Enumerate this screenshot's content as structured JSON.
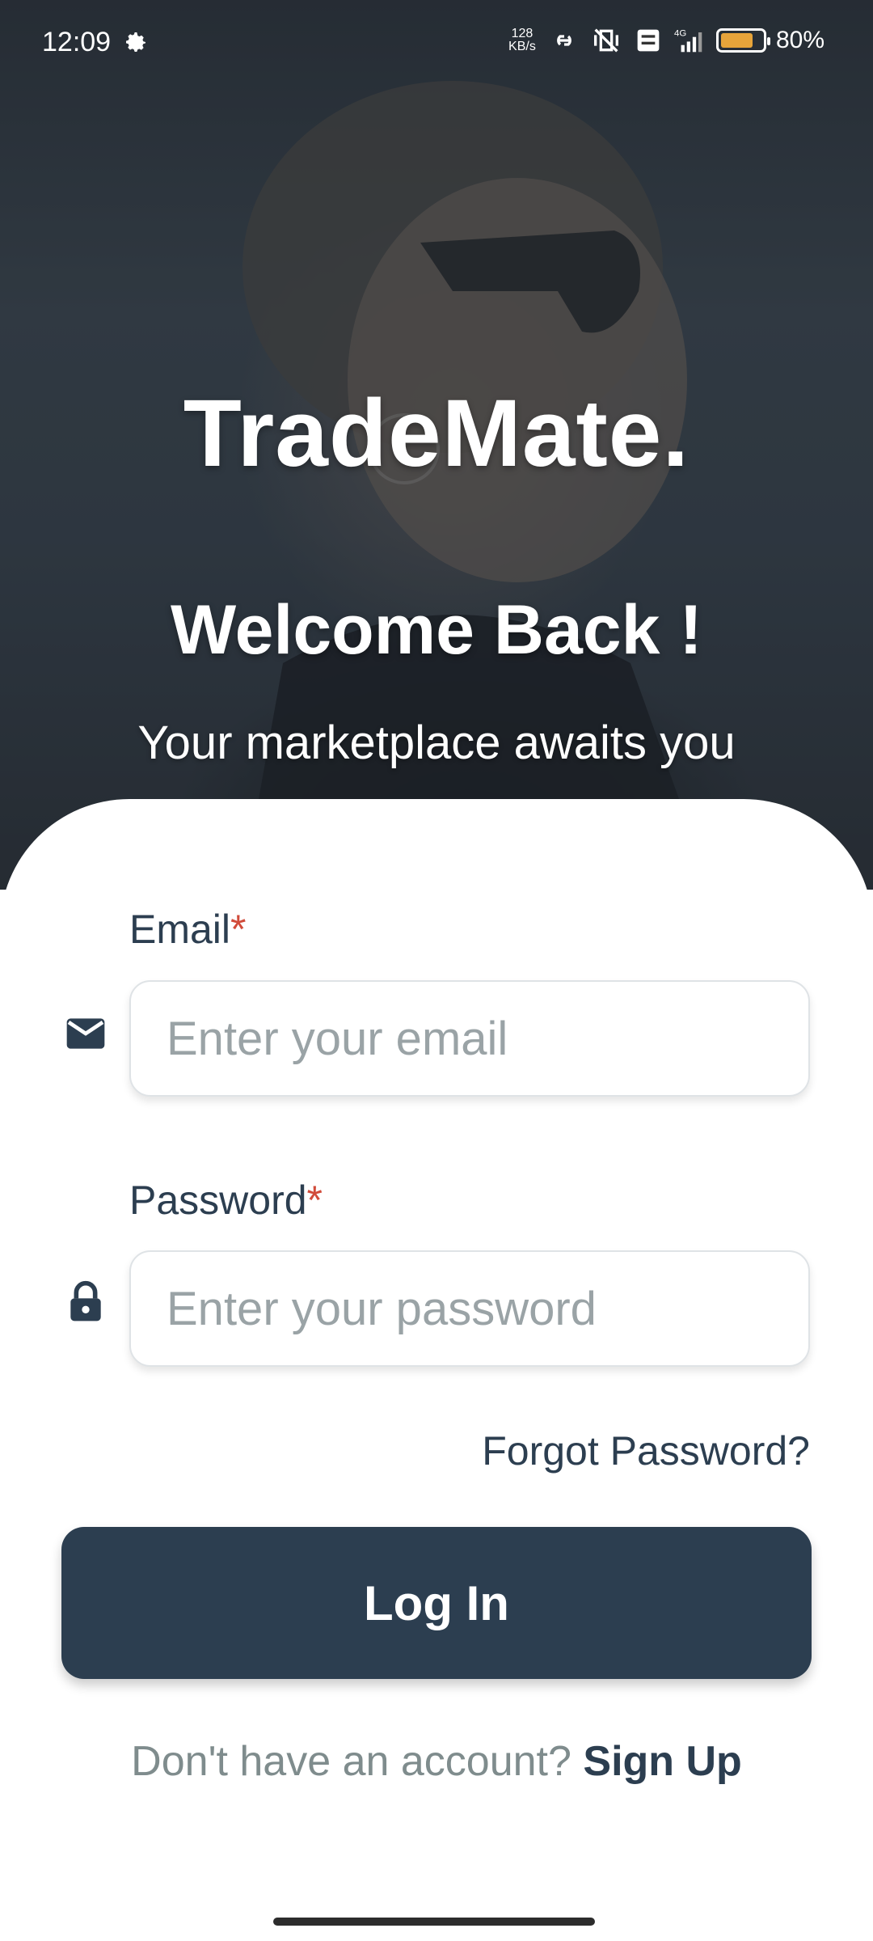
{
  "status_bar": {
    "time": "12:09",
    "speed_top": "128",
    "speed_unit": "KB/s",
    "network": "4G",
    "battery_percent": "80%",
    "battery_level": 0.8
  },
  "hero": {
    "brand": "TradeMate.",
    "welcome": "Welcome Back !",
    "tagline": "Your marketplace awaits you"
  },
  "form": {
    "email_label": "Email",
    "email_required": "*",
    "email_placeholder": "Enter your email",
    "password_label": "Password",
    "password_required": "*",
    "password_placeholder": "Enter your password",
    "forgot_password": "Forgot Password?",
    "login_button": "Log In",
    "signup_prompt": "Don't have an account?",
    "signup_link": "Sign Up"
  },
  "colors": {
    "primary": "#2c3e50",
    "required": "#d14b3a",
    "muted": "#7f8c8d",
    "battery": "#e7a43a"
  },
  "icons": {
    "email": "envelope-icon",
    "password": "lock-icon",
    "settings": "gear-icon"
  }
}
